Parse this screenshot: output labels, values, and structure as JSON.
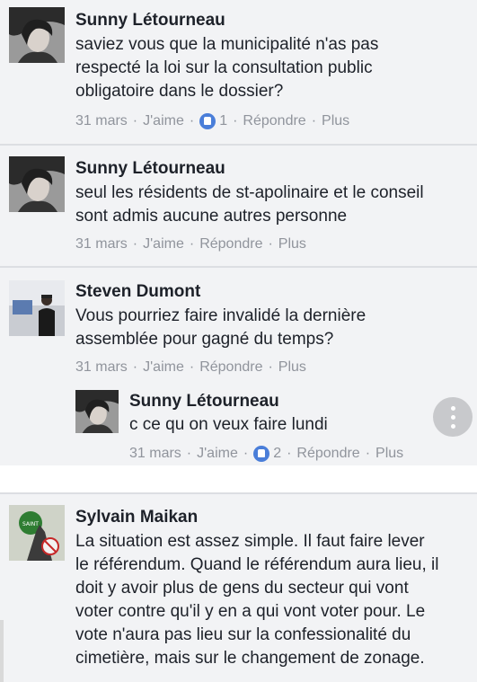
{
  "comments": [
    {
      "name": "Sunny Létourneau",
      "text": "saviez vous que la municipalité n'as pas\nrespecté la loi sur la consultation public\nobligatoire dans le dossier?",
      "date": "31 mars",
      "like": "J'aime",
      "reactions": "1",
      "reply": "Répondre",
      "more": "Plus"
    },
    {
      "name": "Sunny Létourneau",
      "text": "seul les résidents de st-apolinaire et le conseil\nsont admis aucune autres personne",
      "date": "31 mars",
      "like": "J'aime",
      "reply": "Répondre",
      "more": "Plus"
    },
    {
      "name": "Steven Dumont",
      "text": "Vous pourriez faire invalidé la dernière\nassemblée pour gagné du temps?",
      "date": "31 mars",
      "like": "J'aime",
      "reply": "Répondre",
      "more": "Plus"
    },
    {
      "name": "Sunny Létourneau",
      "text": "c ce qu on veux faire lundi",
      "date": "31 mars",
      "like": "J'aime",
      "reactions": "2",
      "reply": "Répondre",
      "more": "Plus"
    },
    {
      "name": "Sylvain Maikan",
      "text": "La situation est assez simple. Il faut faire lever\nle référendum. Quand le référendum aura lieu, il\ndoit y avoir plus de gens du secteur qui vont\nvoter contre qu'il y en a qui vont voter pour. Le\nvote n'aura pas lieu sur la confessionalité du\ncimetière, mais sur le changement de zonage."
    }
  ],
  "colors": {
    "background": "#f2f3f5",
    "name": "#1d2129",
    "meta": "#90949c",
    "like_badge": "#4a7ed9"
  }
}
